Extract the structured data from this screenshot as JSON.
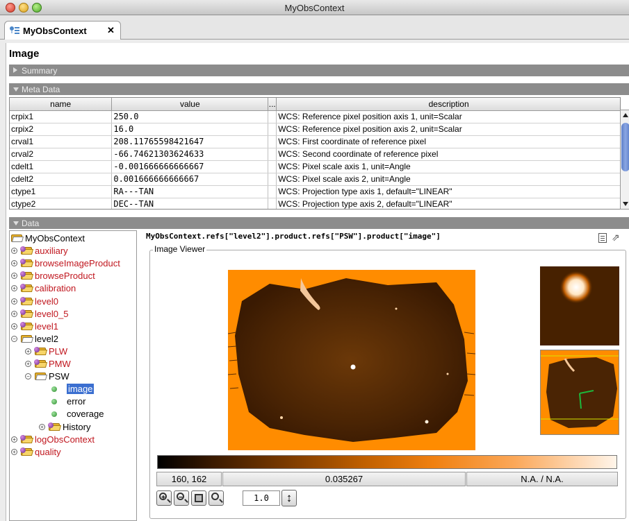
{
  "window": {
    "title": "MyObsContext"
  },
  "tab": {
    "label": "MyObsContext",
    "close": "✕"
  },
  "page": {
    "title": "Image"
  },
  "sections": {
    "summary": "Summary",
    "meta": "Meta Data",
    "data": "Data"
  },
  "meta_table": {
    "columns": [
      "name",
      "value",
      "...",
      "description"
    ],
    "rows": [
      [
        "crpix1",
        "250.0",
        "WCS: Reference pixel position axis 1, unit=Scalar"
      ],
      [
        "crpix2",
        "16.0",
        "WCS: Reference pixel position axis 2, unit=Scalar"
      ],
      [
        "crval1",
        "208.11765598421647",
        "WCS: First coordinate of reference pixel"
      ],
      [
        "crval2",
        "-66.74621303624633",
        "WCS: Second coordinate of reference pixel"
      ],
      [
        "cdelt1",
        "-0.001666666666667",
        "WCS: Pixel scale axis 1, unit=Angle"
      ],
      [
        "cdelt2",
        "0.001666666666667",
        "WCS: Pixel scale axis 2, unit=Angle"
      ],
      [
        "ctype1",
        "RA---TAN",
        "WCS: Projection type axis 1, default=\"LINEAR\""
      ],
      [
        "ctype2",
        "DEC--TAN",
        "WCS: Projection type axis 2, default=\"LINEAR\""
      ]
    ]
  },
  "tree": {
    "root": "MyObsContext",
    "items": [
      "auxiliary",
      "browseImageProduct",
      "browseProduct",
      "calibration",
      "level0",
      "level0_5",
      "level1",
      "level2",
      "PLW",
      "PMW",
      "PSW",
      "image",
      "error",
      "coverage",
      "History",
      "logObsContext",
      "quality"
    ]
  },
  "data_panel": {
    "path": "MyObsContext.refs[\"level2\"].product.refs[\"PSW\"].product[\"image\"]",
    "viewer_title": "Image Viewer",
    "pixel_coord": "160, 162",
    "pixel_value": "0.035267",
    "world_coord": "N.A. / N.A.",
    "zoom": "1.0"
  },
  "colors": {
    "image_orange": "#ff8c00",
    "selection": "#3b6fd0",
    "section_bar": "#8c8c8c",
    "red_label": "#c0161e"
  }
}
